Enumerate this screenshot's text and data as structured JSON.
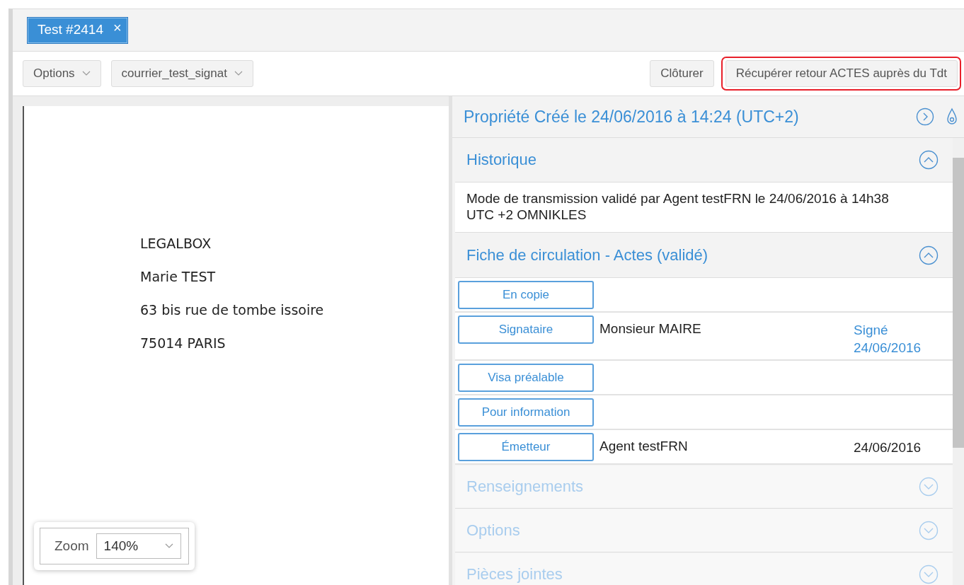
{
  "tabs": [
    {
      "label": "Test #2414",
      "selected": true,
      "close": "×"
    }
  ],
  "toolbar": {
    "left": [
      {
        "label": "Options"
      },
      {
        "label": "courrier_test_signat"
      }
    ],
    "right": [
      {
        "label": "Clôturer",
        "highlighted": false
      },
      {
        "label": "Récupérer retour ACTES auprès du Tdt",
        "highlighted": true
      }
    ]
  },
  "document": {
    "lines": [
      "LEGALBOX",
      "Marie TEST",
      "63 bis rue de tombe issoire",
      "75014 PARIS"
    ],
    "zoom": {
      "label": "Zoom",
      "value": "140%"
    }
  },
  "panel": {
    "title": "Propriété Créé le 24/06/2016 à 14:24 (UTC+2)",
    "sections": [
      {
        "title": "Historique",
        "expanded": true,
        "kind": "text",
        "text": "Mode de transmission validé par Agent testFRN le 24/06/2016 à 14h38 UTC +2 OMNIKLES"
      },
      {
        "title": "Fiche de circulation - Actes (validé)",
        "expanded": true,
        "kind": "circulation",
        "rows": [
          {
            "role": "En copie"
          },
          {
            "role": "Signataire",
            "person": "Monsieur MAIRE",
            "status": "Signé 24/06/2016",
            "signed": true
          },
          {
            "role": "Visa préalable"
          },
          {
            "role": "Pour information"
          },
          {
            "role": "Émetteur",
            "person": "Agent testFRN",
            "status": "24/06/2016",
            "signed": false
          }
        ]
      },
      {
        "title": "Renseignements",
        "expanded": false
      },
      {
        "title": "Options",
        "expanded": false
      },
      {
        "title": "Pièces jointes",
        "expanded": false
      }
    ]
  }
}
